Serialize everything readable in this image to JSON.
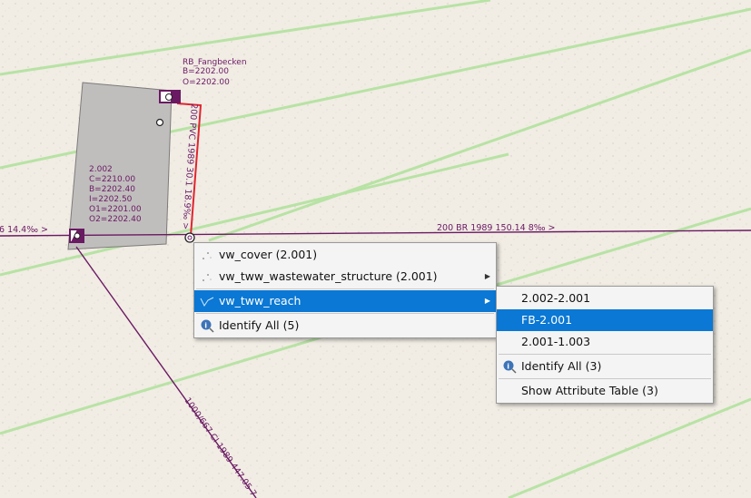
{
  "map": {
    "node_label": {
      "name": "RB_Fangbecken",
      "b": "B=2202.00",
      "o": "O=2202.00"
    },
    "manhole_label": {
      "id": "2.002",
      "c": "C=2210.00",
      "b": "B=2202.40",
      "i": "I=2202.50",
      "o1": "O1=2201.00",
      "o2": "O2=2202.40"
    },
    "reach_labels": {
      "left": "6 14.4‰  >",
      "main": "200 BR 1989 150.14 8‰  >",
      "vertical": "200 PVC 1989 30.1 18.9‰ >",
      "diagonal": "1000/667 CI 1989 447.05 7"
    },
    "colors": {
      "reach": "#6a1a63",
      "selected_reach": "#e0242f",
      "structure_fill": "#c0bebd",
      "highlight": "#0a78d4"
    }
  },
  "context_menu": {
    "items": [
      {
        "label": "vw_cover (2.001)",
        "icon": "point-layer-icon",
        "submenu": false
      },
      {
        "label": "vw_tww_wastewater_structure (2.001)",
        "icon": "point-layer-icon",
        "submenu": true
      },
      {
        "label": "vw_tww_reach",
        "icon": "line-layer-icon",
        "submenu": true,
        "selected": true
      },
      {
        "label": "Identify All (5)",
        "icon": "identify-icon",
        "submenu": false
      }
    ]
  },
  "submenu": {
    "items": [
      {
        "label": "2.002-2.001"
      },
      {
        "label": "FB-2.001",
        "selected": true
      },
      {
        "label": "2.001-1.003"
      },
      {
        "label": "Identify All (3)",
        "icon": "identify-icon"
      },
      {
        "label": "Show Attribute Table (3)"
      }
    ]
  }
}
